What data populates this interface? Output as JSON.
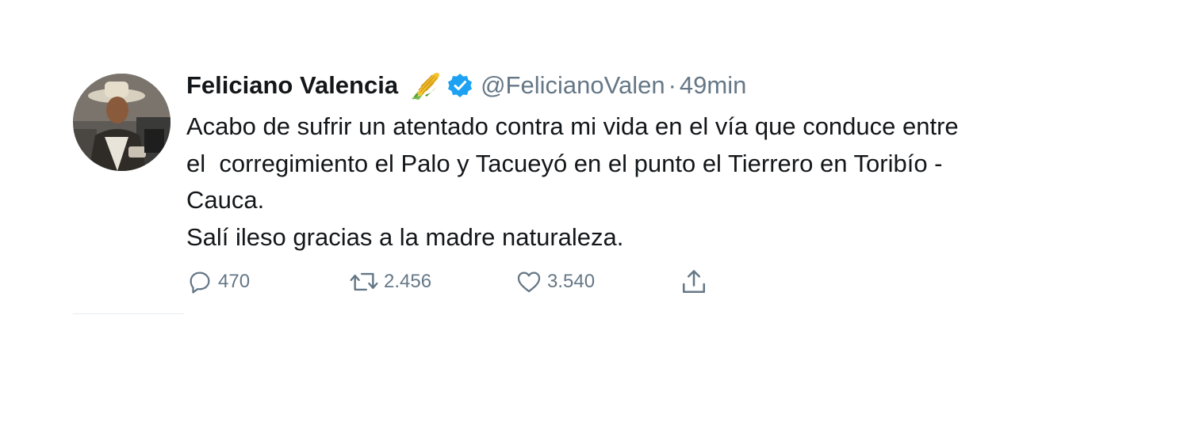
{
  "tweet": {
    "author_name": "Feliciano Valencia",
    "author_emoji": "corn-emoji",
    "verified": true,
    "handle": "@FelicianoValen",
    "separator": "·",
    "time": "49min",
    "text_lines": [
      "Acabo de sufrir un atentado contra mi vida en el vía que conduce entre",
      "el  corregimiento el Palo y Tacueyó en el punto el Tierrero en Toribío -",
      "Cauca.",
      "Salí ileso gracias a la madre naturaleza."
    ],
    "actions": {
      "replies": "470",
      "retweets": "2.456",
      "likes": "3.540"
    }
  },
  "colors": {
    "text": "#14171a",
    "secondary": "#657786",
    "verified_blue": "#1da1f2",
    "divider": "#e6ecf0"
  }
}
